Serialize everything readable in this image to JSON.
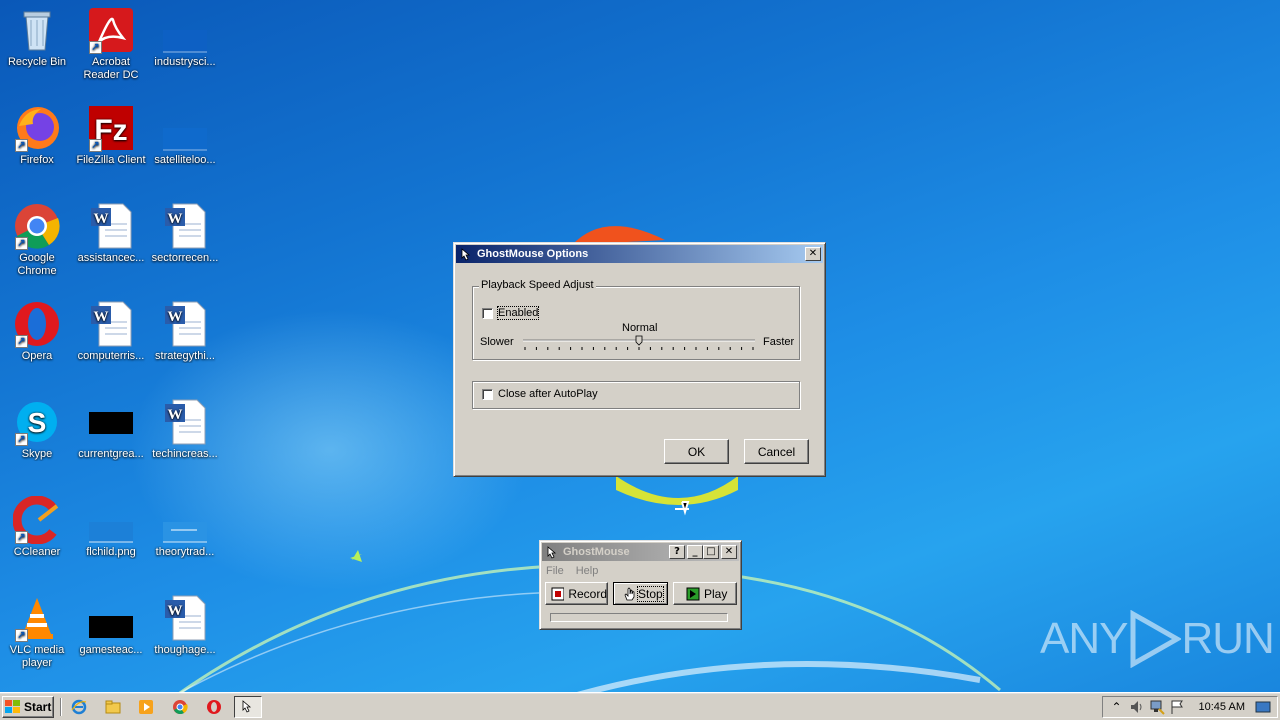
{
  "desktop": {
    "icons": [
      {
        "label": "Recycle Bin",
        "icon": "recycle-bin-icon"
      },
      {
        "label": "Acrobat Reader DC",
        "icon": "acrobat-reader-icon"
      },
      {
        "label": "industrysci...",
        "icon": "blank-file-icon"
      },
      {
        "label": "Firefox",
        "icon": "firefox-icon"
      },
      {
        "label": "FileZilla Client",
        "icon": "filezilla-icon"
      },
      {
        "label": "satelliteloo...",
        "icon": "blank-file-icon"
      },
      {
        "label": "Google Chrome",
        "icon": "chrome-icon"
      },
      {
        "label": "assistancec...",
        "icon": "word-doc-icon"
      },
      {
        "label": "sectorrecen...",
        "icon": "word-doc-icon"
      },
      {
        "label": "Opera",
        "icon": "opera-icon"
      },
      {
        "label": "computerris...",
        "icon": "word-doc-icon"
      },
      {
        "label": "strategythi...",
        "icon": "word-doc-icon"
      },
      {
        "label": "Skype",
        "icon": "skype-icon"
      },
      {
        "label": "currentgrea...",
        "icon": "black-image-icon"
      },
      {
        "label": "techincreas...",
        "icon": "word-doc-icon"
      },
      {
        "label": "CCleaner",
        "icon": "ccleaner-icon"
      },
      {
        "label": "flchild.png",
        "icon": "image-file-icon"
      },
      {
        "label": "theorytrad...",
        "icon": "image-file-icon"
      },
      {
        "label": "VLC media player",
        "icon": "vlc-icon"
      },
      {
        "label": "gamesteac...",
        "icon": "black-image-icon"
      },
      {
        "label": "thoughage...",
        "icon": "word-doc-icon"
      }
    ]
  },
  "options_dialog": {
    "title": "GhostMouse Options",
    "close": "✕",
    "playback_group": "Playback Speed Adjust",
    "enabled_label": "Enabled",
    "enabled_checked": false,
    "speed_center_label": "Normal",
    "slower_label": "Slower",
    "faster_label": "Faster",
    "speed_value": 0.5,
    "close_after_label": "Close after AutoPlay",
    "close_after_checked": false,
    "ok_label": "OK",
    "cancel_label": "Cancel"
  },
  "ghostmouse_window": {
    "title": "GhostMouse",
    "help_btn": "?",
    "min_btn": "_",
    "max_btn": "□",
    "close_btn": "✕",
    "menu": [
      "File",
      "Help"
    ],
    "record_label": "Record",
    "stop_label": "Stop",
    "play_label": "Play",
    "progress": 0
  },
  "taskbar": {
    "start_label": "Start",
    "clock": "10:45 AM",
    "pinned": [
      "ie-icon",
      "explorer-icon",
      "media-player-icon",
      "chrome-icon",
      "opera-icon",
      "ghostmouse-icon"
    ]
  },
  "watermark": {
    "left": "ANY",
    "right": "RUN"
  },
  "colors": {
    "title_active": "#0a246a",
    "title_active_end": "#a6caf0",
    "face": "#d4d0c8",
    "desktop": "#1374d1"
  }
}
